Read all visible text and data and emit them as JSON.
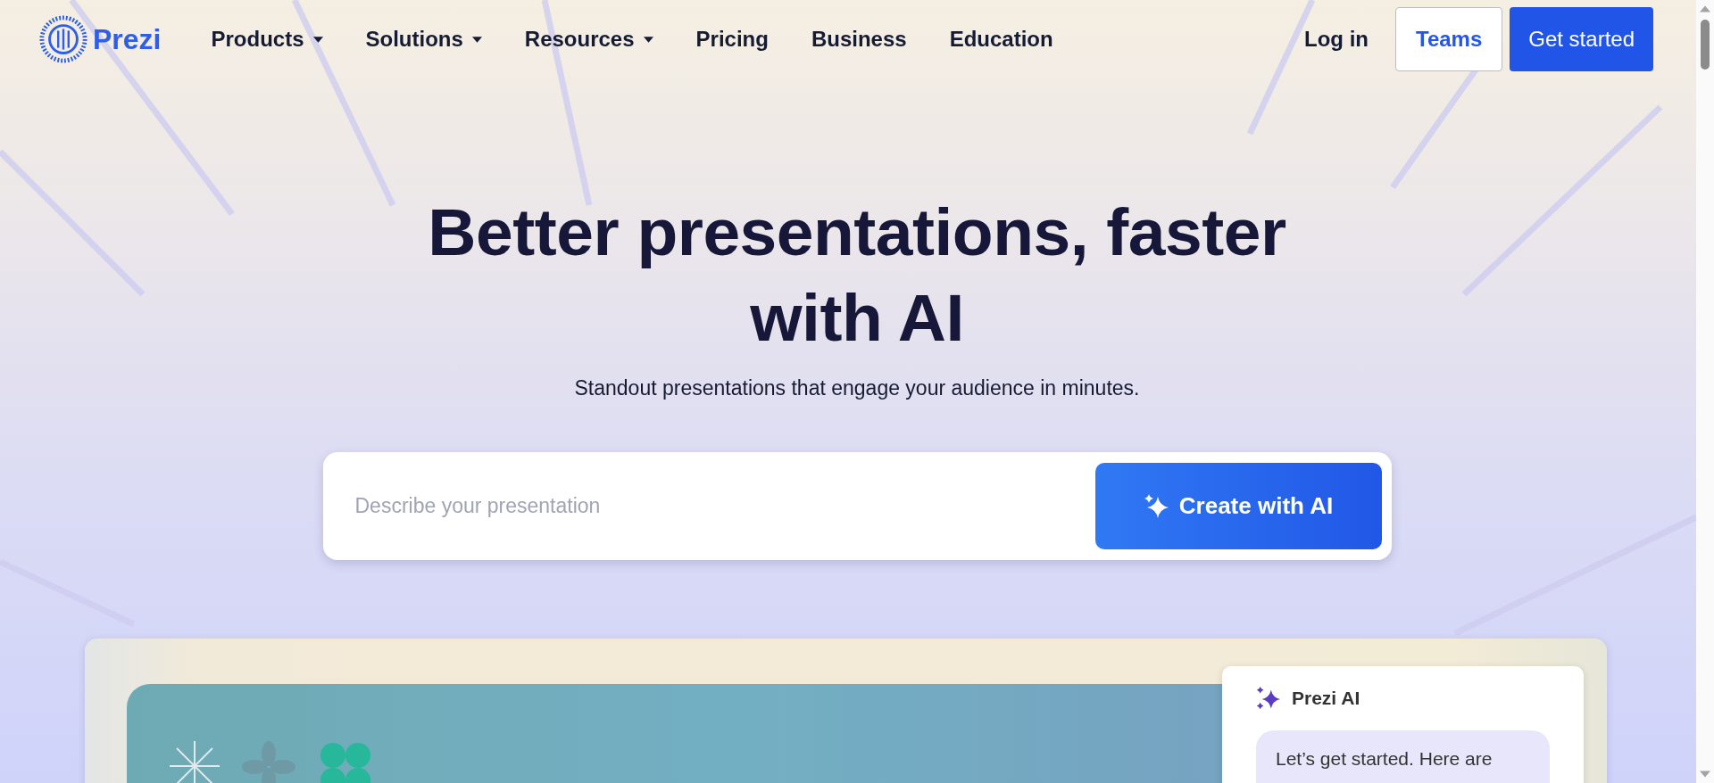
{
  "logo": {
    "text": "Prezi"
  },
  "nav": [
    {
      "label": "Products",
      "dropdown": true
    },
    {
      "label": "Solutions",
      "dropdown": true
    },
    {
      "label": "Resources",
      "dropdown": true
    },
    {
      "label": "Pricing",
      "dropdown": false
    },
    {
      "label": "Business",
      "dropdown": false
    },
    {
      "label": "Education",
      "dropdown": false
    }
  ],
  "actions": {
    "login": "Log in",
    "teams": "Teams",
    "get_started": "Get started"
  },
  "hero": {
    "headline": "Better presentations, faster with AI",
    "subtitle": "Standout presentations that engage your audience in minutes."
  },
  "prompt": {
    "placeholder": "Describe your presentation",
    "button": "Create with AI"
  },
  "preview": {
    "chat": {
      "title": "Prezi AI",
      "message": "Let’s get started. Here are"
    }
  }
}
